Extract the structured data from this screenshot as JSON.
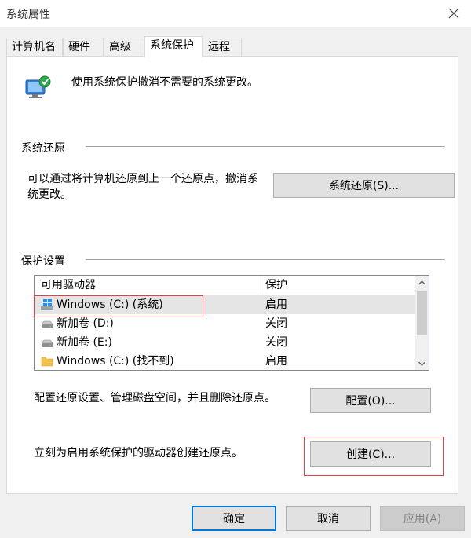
{
  "window": {
    "title": "系统属性",
    "close_icon": "close-icon"
  },
  "tabs": [
    {
      "label": "计算机名"
    },
    {
      "label": "硬件"
    },
    {
      "label": "高级"
    },
    {
      "label": "系统保护",
      "active": true
    },
    {
      "label": "远程"
    }
  ],
  "intro": {
    "text": "使用系统保护撤消不需要的系统更改。",
    "icon": "system-protection-icon"
  },
  "system_restore": {
    "section_title": "系统还原",
    "description": "可以通过将计算机还原到上一个还原点，撤消系统更改。",
    "description_line1": "可以通过将计算机还原到上一个还原点，撤消系",
    "description_line2": "统更改。",
    "button_label": "系统还原(S)..."
  },
  "protection_settings": {
    "section_title": "保护设置",
    "columns": [
      "可用驱动器",
      "保护"
    ],
    "drives": [
      {
        "name": "Windows (C:) (系统)",
        "protection": "启用",
        "icon": "windows-drive-icon",
        "selected": true
      },
      {
        "name": "新加卷 (D:)",
        "protection": "关闭",
        "icon": "drive-icon"
      },
      {
        "name": "新加卷 (E:)",
        "protection": "关闭",
        "icon": "drive-icon"
      },
      {
        "name": "Windows (C:) (找不到)",
        "protection": "启用",
        "icon": "folder-icon"
      }
    ],
    "configure_text": "配置还原设置、管理磁盘空间，并且删除还原点。",
    "configure_button": "配置(O)...",
    "create_text": "立刻为启用系统保护的驱动器创建还原点。",
    "create_button": "创建(C)..."
  },
  "footer": {
    "ok": "确定",
    "cancel": "取消",
    "apply": "应用(A)"
  },
  "colors": {
    "accent": "#0078d7",
    "highlight": "#e04040"
  }
}
